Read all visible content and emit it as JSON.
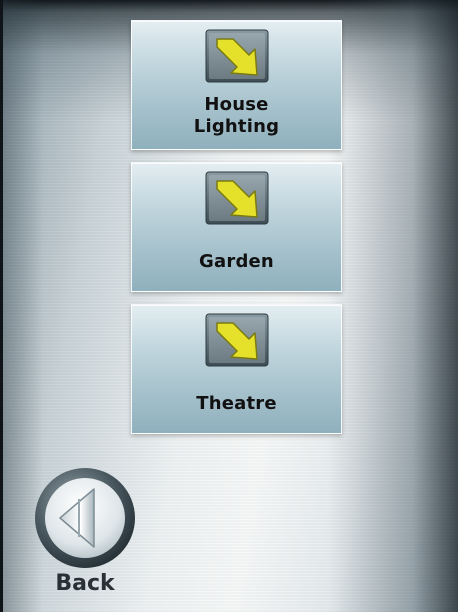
{
  "menu": {
    "items": [
      {
        "label_line1": "House",
        "label_line2": "Lighting",
        "icon": "arrow-down-right-icon"
      },
      {
        "label": "Garden",
        "icon": "arrow-down-right-icon"
      },
      {
        "label": "Theatre",
        "icon": "arrow-down-right-icon"
      }
    ]
  },
  "back": {
    "label": "Back",
    "icon": "back-arrow-icon"
  },
  "colors": {
    "arrow_fill": "#e5e02a",
    "arrow_stroke": "#7a7a12",
    "icon_frame": "#5e6f78",
    "tile_top": "#e4eef2",
    "tile_bottom": "#8fb0bd"
  }
}
